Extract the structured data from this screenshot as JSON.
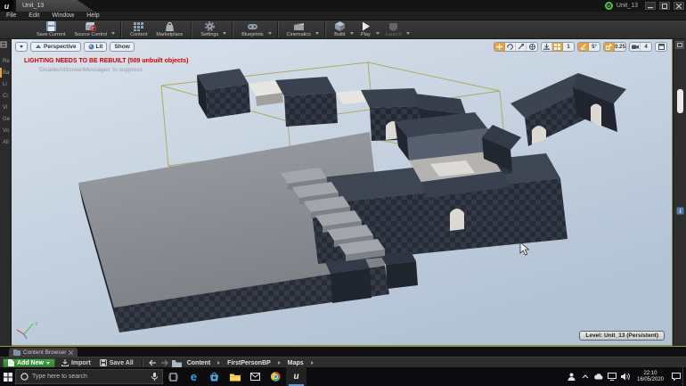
{
  "window": {
    "app_tab": "Unit_13",
    "project_label": "Unit_13",
    "logo_glyph": "u"
  },
  "menu": {
    "items": [
      "File",
      "Edit",
      "Window",
      "Help"
    ]
  },
  "toolbar": {
    "buttons": [
      "Save Current",
      "Source Control",
      "Content",
      "Marketplace",
      "Settings",
      "Blueprints",
      "Cinematics",
      "Build",
      "Play",
      "Launch"
    ]
  },
  "place_panel": {
    "tabs": [
      "Re",
      "Ba",
      "Li",
      "Ci",
      "Vi",
      "Ge",
      "Vo",
      "All"
    ]
  },
  "viewport": {
    "perspective_label": "Perspective",
    "lit_label": "Lit",
    "show_label": "Show",
    "warning_title": "LIGHTING NEEDS TO BE REBUILT (509 unbuilt objects)",
    "warning_subtitle": "'DisableAllScreenMessages' to suppress",
    "snap": {
      "grid": "1",
      "rotation": "5°",
      "scale": "0.25",
      "camera_speed": "4"
    },
    "level_badge": "Level:  Unit_13 (Persistent)",
    "axis_z_label": "z"
  },
  "content_browser": {
    "tab_label": "Content Browser",
    "add_new_label": "Add New",
    "import_label": "Import",
    "save_all_label": "Save All",
    "breadcrumbs": [
      "Content",
      "FirstPersonBP",
      "Maps"
    ]
  },
  "taskbar": {
    "search_placeholder": "Type here to search",
    "time": "22:10",
    "date": "16/05/2020",
    "edge_glyph": "e",
    "ue_glyph": "u"
  },
  "colors": {
    "accent_orange": "#e8a23c",
    "warning_red": "#cf0000",
    "add_new_green": "#3c9b3c",
    "wireframe_yellow": "#a8a850",
    "sky_top": "#dae2eb",
    "sky_bottom": "#b2c2d5"
  }
}
